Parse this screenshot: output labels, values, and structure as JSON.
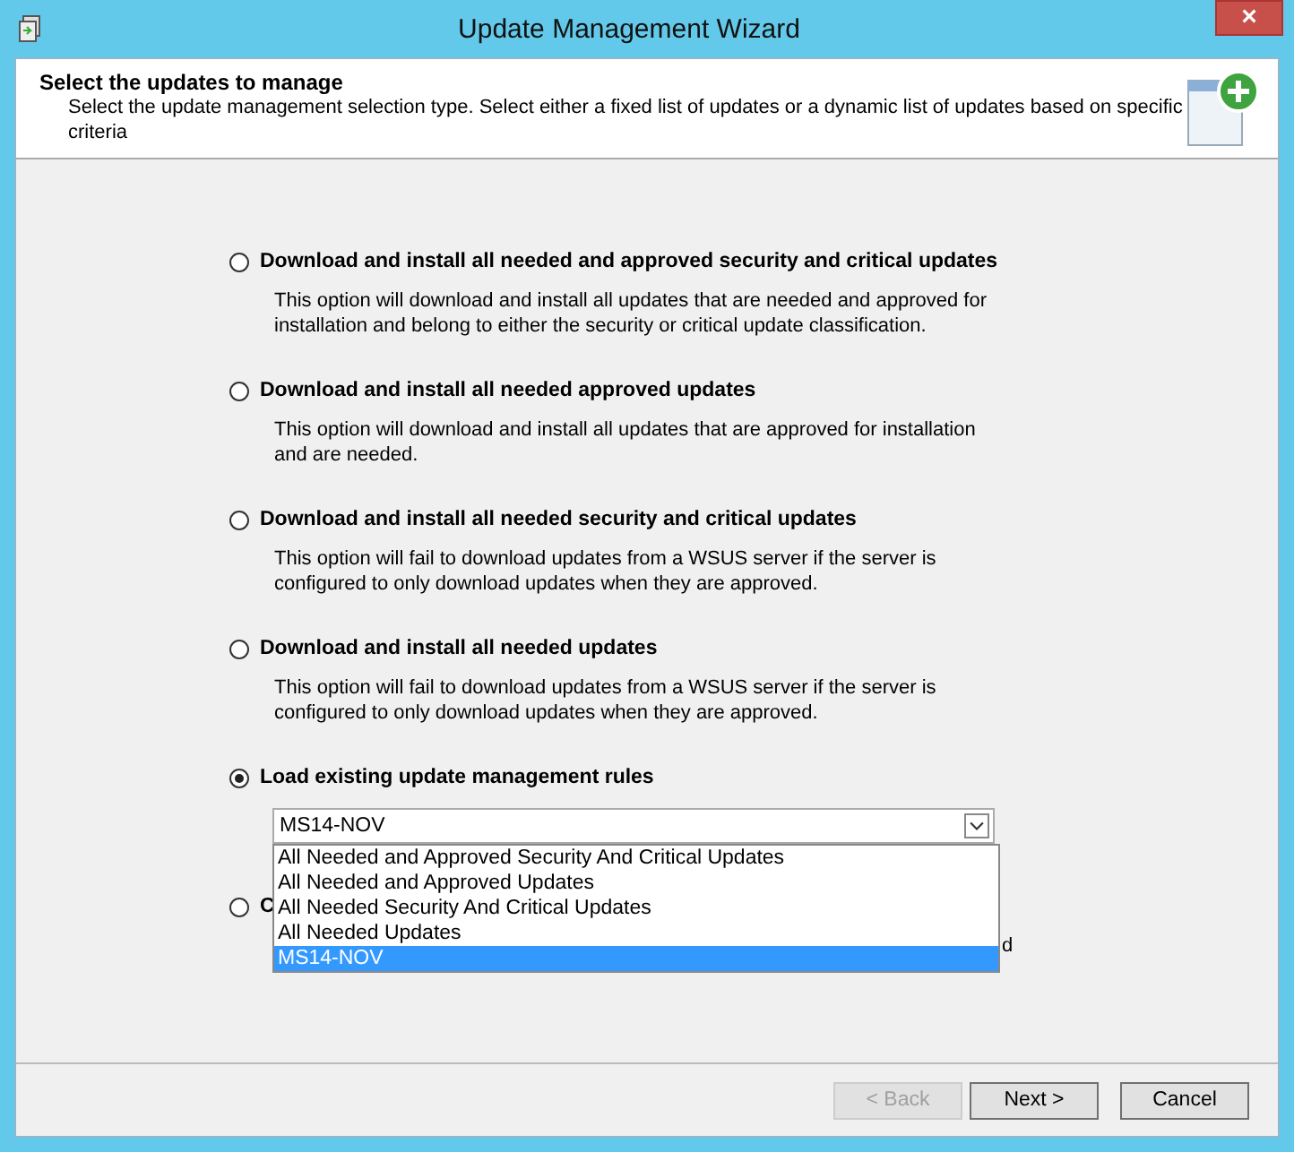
{
  "window": {
    "title": "Update Management Wizard",
    "close": "×"
  },
  "header": {
    "title": "Select the updates to manage",
    "subtitle": "Select the update management selection type. Select either a fixed list of updates or a dynamic list of updates based on specific criteria"
  },
  "options": [
    {
      "label": "Download and install all needed and approved security and critical updates",
      "selected": false,
      "description": [
        "This option will download and install all updates that are needed and approved for installation and belong to either the security or critical update classification."
      ]
    },
    {
      "label": "Download and install all needed approved updates",
      "selected": false,
      "description": [
        "This option will download and install all updates that are approved for installation and are needed."
      ]
    },
    {
      "label": "Download and install all needed security and critical updates",
      "selected": false,
      "description": [
        "This option will fail to download updates from a WSUS server if the server is configured to only download updates when they are approved."
      ]
    },
    {
      "label": "Download and install all needed updates",
      "selected": false,
      "description": [
        "This option will fail to download updates from a WSUS server if the server is configured to only download updates when they are approved."
      ]
    },
    {
      "label": "Load existing update management rules",
      "selected": true
    },
    {
      "label": "C",
      "selected": false,
      "description": [
        "d"
      ]
    }
  ],
  "combo": {
    "value": "MS14-NOV",
    "items": [
      {
        "label": "All Needed and Approved Security And Critical Updates",
        "selected": false
      },
      {
        "label": "All Needed and Approved Updates",
        "selected": false
      },
      {
        "label": "All Needed Security And Critical Updates",
        "selected": false
      },
      {
        "label": "All Needed Updates",
        "selected": false
      },
      {
        "label": "MS14-NOV",
        "selected": true
      }
    ]
  },
  "buttons": [
    {
      "label": "< Back",
      "disabled": true
    },
    {
      "label": "Next >",
      "disabled": false
    },
    {
      "label": "Cancel",
      "disabled": false
    }
  ]
}
